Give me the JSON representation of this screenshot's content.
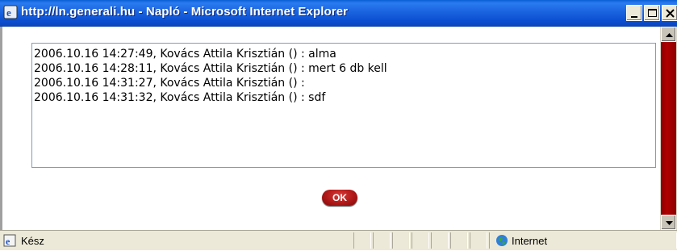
{
  "window": {
    "title": "http://ln.generali.hu - Napló - Microsoft Internet Explorer",
    "app_icon": "ie-icon",
    "buttons": [
      "minimize-icon",
      "maximize-icon",
      "close-icon"
    ]
  },
  "log": {
    "lines": [
      "2006.10.16 14:27:49, Kovács Attila Krisztián () : alma",
      "2006.10.16 14:28:11, Kovács Attila Krisztián () : mert 6 db kell",
      "2006.10.16 14:31:27, Kovács Attila Krisztián () :",
      "2006.10.16 14:31:32, Kovács Attila Krisztián () : sdf"
    ]
  },
  "ok_button": {
    "label": "OK",
    "color": "#b01818"
  },
  "statusbar": {
    "status": "Kész",
    "zone": "Internet",
    "status_icon": "ie-page-icon",
    "zone_icon": "globe-icon"
  },
  "colors": {
    "titlebar": "#1b64e0",
    "scrollbar_track": "#b00000",
    "statusbar": "#ece9d8"
  }
}
